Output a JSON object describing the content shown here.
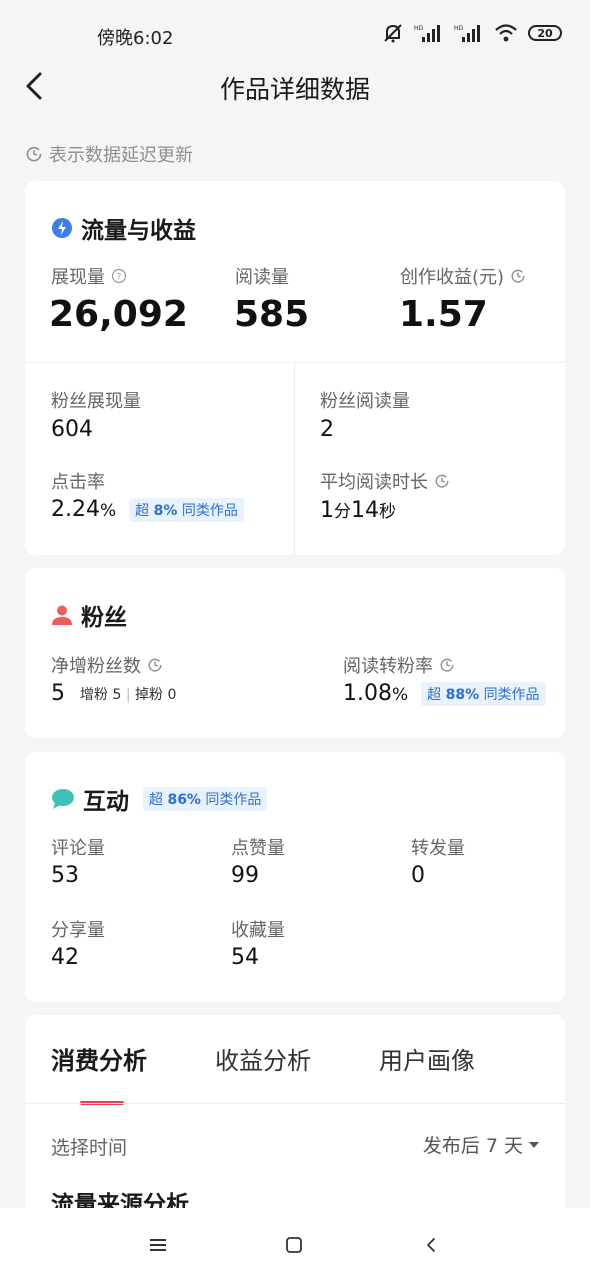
{
  "status_bar": {
    "time": "傍晚6:02",
    "battery": "20"
  },
  "header": {
    "title": "作品详细数据"
  },
  "notice": {
    "text": "表示数据延迟更新"
  },
  "traffic": {
    "title": "流量与收益",
    "impressions_label": "展现量",
    "impressions_value": "26,092",
    "reads_label": "阅读量",
    "reads_value": "585",
    "earnings_label": "创作收益(元)",
    "earnings_value": "1.57",
    "fan_impressions_label": "粉丝展现量",
    "fan_impressions_value": "604",
    "fan_reads_label": "粉丝阅读量",
    "fan_reads_value": "2",
    "ctr_label": "点击率",
    "ctr_value": "2.24",
    "ctr_unit": "%",
    "ctr_badge_prefix": "超",
    "ctr_badge_pct": "8%",
    "ctr_badge_suffix": "同类作品",
    "avg_read_label": "平均阅读时长",
    "avg_read_min": "1",
    "avg_read_min_unit": "分",
    "avg_read_sec": "14",
    "avg_read_sec_unit": "秒"
  },
  "fans": {
    "title": "粉丝",
    "net_label": "净增粉丝数",
    "net_value": "5",
    "gain_label": "增粉",
    "gain_value": "5",
    "lose_label": "掉粉",
    "lose_value": "0",
    "conv_label": "阅读转粉率",
    "conv_value": "1.08",
    "conv_unit": "%",
    "conv_badge_prefix": "超",
    "conv_badge_pct": "88%",
    "conv_badge_suffix": "同类作品"
  },
  "interaction": {
    "title": "互动",
    "badge_prefix": "超",
    "badge_pct": "86%",
    "badge_suffix": "同类作品",
    "comments_label": "评论量",
    "comments_value": "53",
    "likes_label": "点赞量",
    "likes_value": "99",
    "shares_fwd_label": "转发量",
    "shares_fwd_value": "0",
    "share_label": "分享量",
    "share_value": "42",
    "fav_label": "收藏量",
    "fav_value": "54"
  },
  "tabs": {
    "items": [
      "消费分析",
      "收益分析",
      "用户画像"
    ],
    "time_label": "选择时间",
    "time_value": "发布后 7 天",
    "section_title": "流量来源分析"
  },
  "colors": {
    "accent_red": "#e63e4b",
    "badge_blue": "#2d6fd6",
    "traffic_icon": "#3d7ee8",
    "fans_icon": "#ef5b5b",
    "interact_icon": "#3fc1b8"
  }
}
